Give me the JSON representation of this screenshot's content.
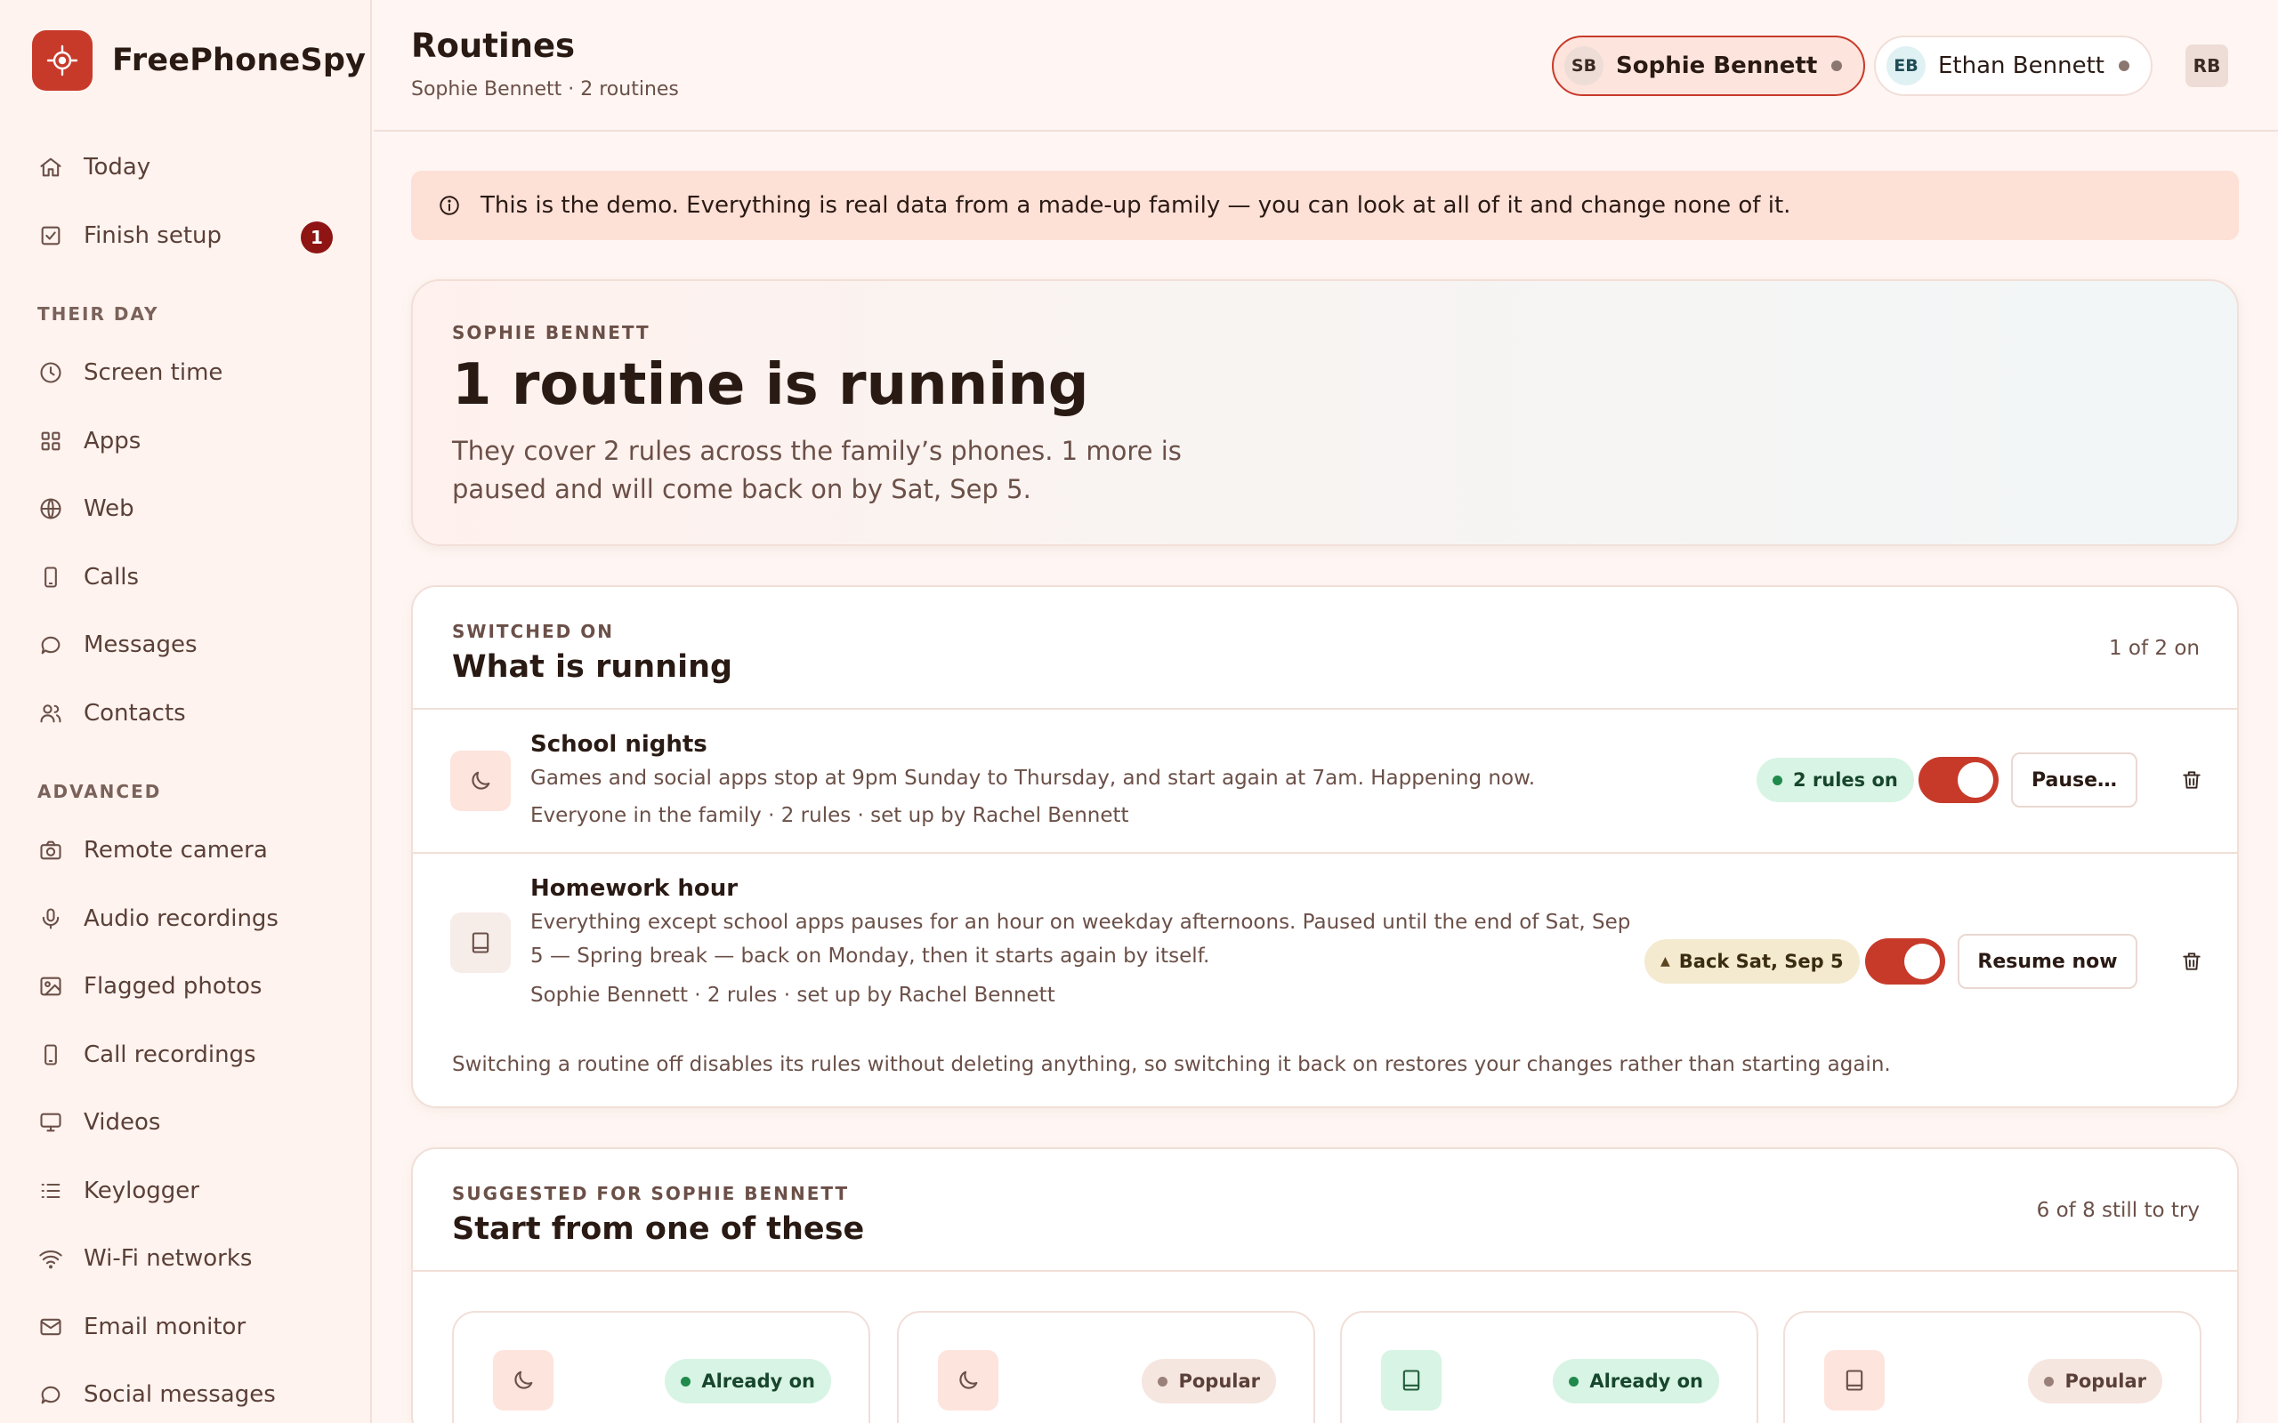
{
  "app": {
    "name": "FreePhoneSpy"
  },
  "sidebar": {
    "top_items": [
      {
        "label": "Today",
        "icon": "home-icon"
      },
      {
        "label": "Finish setup",
        "icon": "checklist-icon",
        "badge": "1"
      }
    ],
    "sections": [
      {
        "title": "THEIR DAY",
        "items": [
          {
            "label": "Screen time",
            "icon": "clock-icon"
          },
          {
            "label": "Apps",
            "icon": "apps-grid-icon"
          },
          {
            "label": "Web",
            "icon": "globe-icon"
          },
          {
            "label": "Calls",
            "icon": "phone-icon"
          },
          {
            "label": "Messages",
            "icon": "chat-bubble-icon"
          },
          {
            "label": "Contacts",
            "icon": "people-icon"
          }
        ]
      },
      {
        "title": "ADVANCED",
        "items": [
          {
            "label": "Remote camera",
            "icon": "camera-icon"
          },
          {
            "label": "Audio recordings",
            "icon": "microphone-icon"
          },
          {
            "label": "Flagged photos",
            "icon": "image-icon"
          },
          {
            "label": "Call recordings",
            "icon": "phone-recording-icon"
          },
          {
            "label": "Videos",
            "icon": "monitor-icon"
          },
          {
            "label": "Keylogger",
            "icon": "list-icon"
          },
          {
            "label": "Wi-Fi networks",
            "icon": "wifi-icon"
          },
          {
            "label": "Email monitor",
            "icon": "mail-icon"
          },
          {
            "label": "Social messages",
            "icon": "social-chat-icon"
          }
        ]
      }
    ]
  },
  "header": {
    "title": "Routines",
    "subtitle": "Sophie Bennett · 2 routines",
    "profiles": [
      {
        "initials": "SB",
        "name": "Sophie Bennett",
        "selected": true
      },
      {
        "initials": "EB",
        "name": "Ethan Bennett",
        "selected": false
      }
    ],
    "account_initials": "RB"
  },
  "banner": {
    "text": "This is the demo. Everything is real data from a made-up family — you can look at all of it and change none of it."
  },
  "hero": {
    "eyebrow": "SOPHIE BENNETT",
    "title": "1 routine is running",
    "body": "They cover 2 rules across the family’s phones. 1 more is paused and will come back on by Sat, Sep 5."
  },
  "running": {
    "eyebrow": "SWITCHED ON",
    "title": "What is running",
    "count": "1 of 2 on",
    "routines": [
      {
        "name": "School nights",
        "icon": "moon-icon",
        "description": "Games and social apps stop at 9pm Sunday to Thursday, and start again at 7am. Happening now.",
        "meta": "Everyone in the family · 2 rules · set up by Rachel Bennett",
        "status": "2 rules on",
        "toggle_on": true,
        "action": "Pause…"
      },
      {
        "name": "Homework hour",
        "icon": "book-icon",
        "description": "Everything except school apps pauses for an hour on weekday afternoons. Paused until the end of Sat, Sep 5 — Spring break — back on Monday, then it starts again by itself.",
        "meta": "Sophie Bennett · 2 rules · set up by Rachel Bennett",
        "status": "Back Sat, Sep 5",
        "status_glyph": "▲",
        "toggle_on": true,
        "action": "Resume now"
      }
    ],
    "note": "Switching a routine off disables its rules without deleting anything, so switching it back on restores your changes rather than starting again."
  },
  "suggested": {
    "eyebrow": "SUGGESTED FOR SOPHIE BENNETT",
    "title": "Start from one of these",
    "count": "6 of 8 still to try",
    "tiles": [
      {
        "icon": "moon-icon",
        "badge": "Already on"
      },
      {
        "icon": "moon-icon",
        "badge": "Popular"
      },
      {
        "icon": "book-icon",
        "badge": "Already on"
      },
      {
        "icon": "book-icon",
        "badge": "Popular"
      }
    ]
  },
  "colors": {
    "brand": "#c73a2a",
    "badge": "#8f1414",
    "success": "#1f8a4c",
    "background": "#fff6f3"
  }
}
